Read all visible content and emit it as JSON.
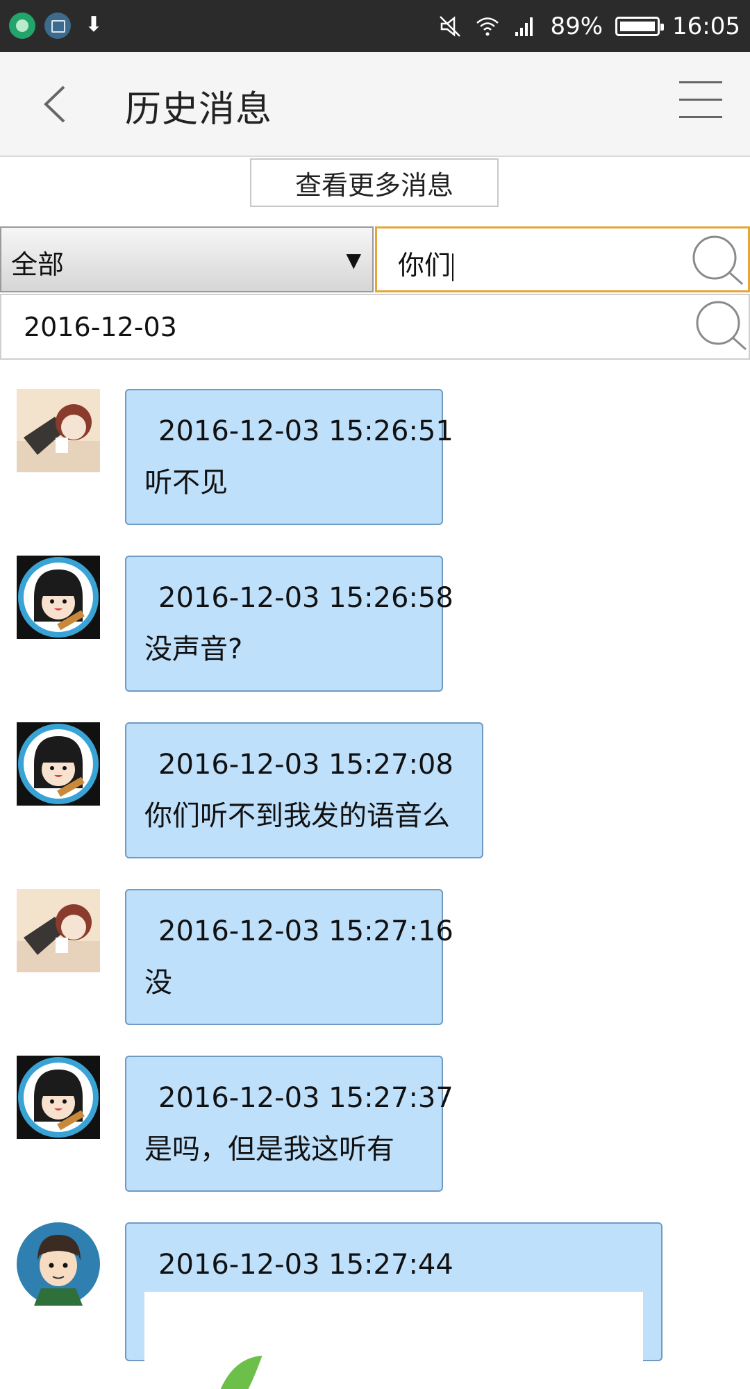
{
  "status_bar": {
    "battery": "89%",
    "time": "16:05"
  },
  "header": {
    "title": "历史消息"
  },
  "more_button": {
    "label": "查看更多消息"
  },
  "filter": {
    "selected": "全部",
    "search_value": "你们",
    "date_value": "2016-12-03"
  },
  "messages": [
    {
      "time": "2016-12-03 15:26:51",
      "text": "听不见"
    },
    {
      "time": "2016-12-03 15:26:58",
      "text": "没声音?"
    },
    {
      "time": "2016-12-03 15:27:08",
      "text": "你们听不到我发的语音么"
    },
    {
      "time": "2016-12-03 15:27:16",
      "text": "没"
    },
    {
      "time": "2016-12-03 15:27:37",
      "text": "是吗，但是我这听有"
    },
    {
      "time": "2016-12-03 15:27:44",
      "text": ""
    }
  ],
  "colors": {
    "bubble": "#bfe0fb",
    "bubble_border": "#6f9bc2",
    "search_focus": "#e3a63a",
    "status_bar": "#2b2b2b"
  },
  "icons": {
    "back": "chevron-left-icon",
    "menu": "hamburger-menu-icon",
    "search": "search-icon"
  }
}
